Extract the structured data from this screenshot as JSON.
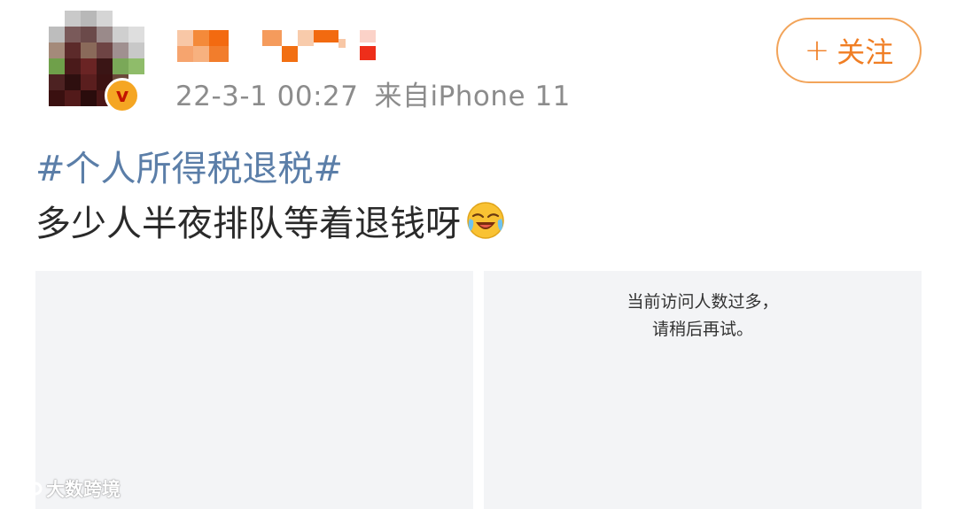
{
  "post": {
    "meta": {
      "timestamp": "22-3-1 00:27",
      "source": "来自iPhone 11"
    },
    "follow_label": "关注",
    "follow_plus": "+",
    "topic": "#个人所得税退税#",
    "text": "多少人半夜排队等着退钱呀",
    "emoji": "laughing-crying-emoji",
    "images": {
      "right_error_line1": "当前访问人数过多，",
      "right_error_line2": "请稍后再试。"
    }
  },
  "watermark": {
    "text": "大数跨境",
    "logo": "watermark-logo-icon"
  },
  "colors": {
    "accent": "#f07e24",
    "follow_border": "#f2a45a",
    "topic": "#5b7ea8",
    "meta": "#8c8c8c",
    "image_bg": "#f3f4f6",
    "verified_badge": "#f5a623"
  }
}
